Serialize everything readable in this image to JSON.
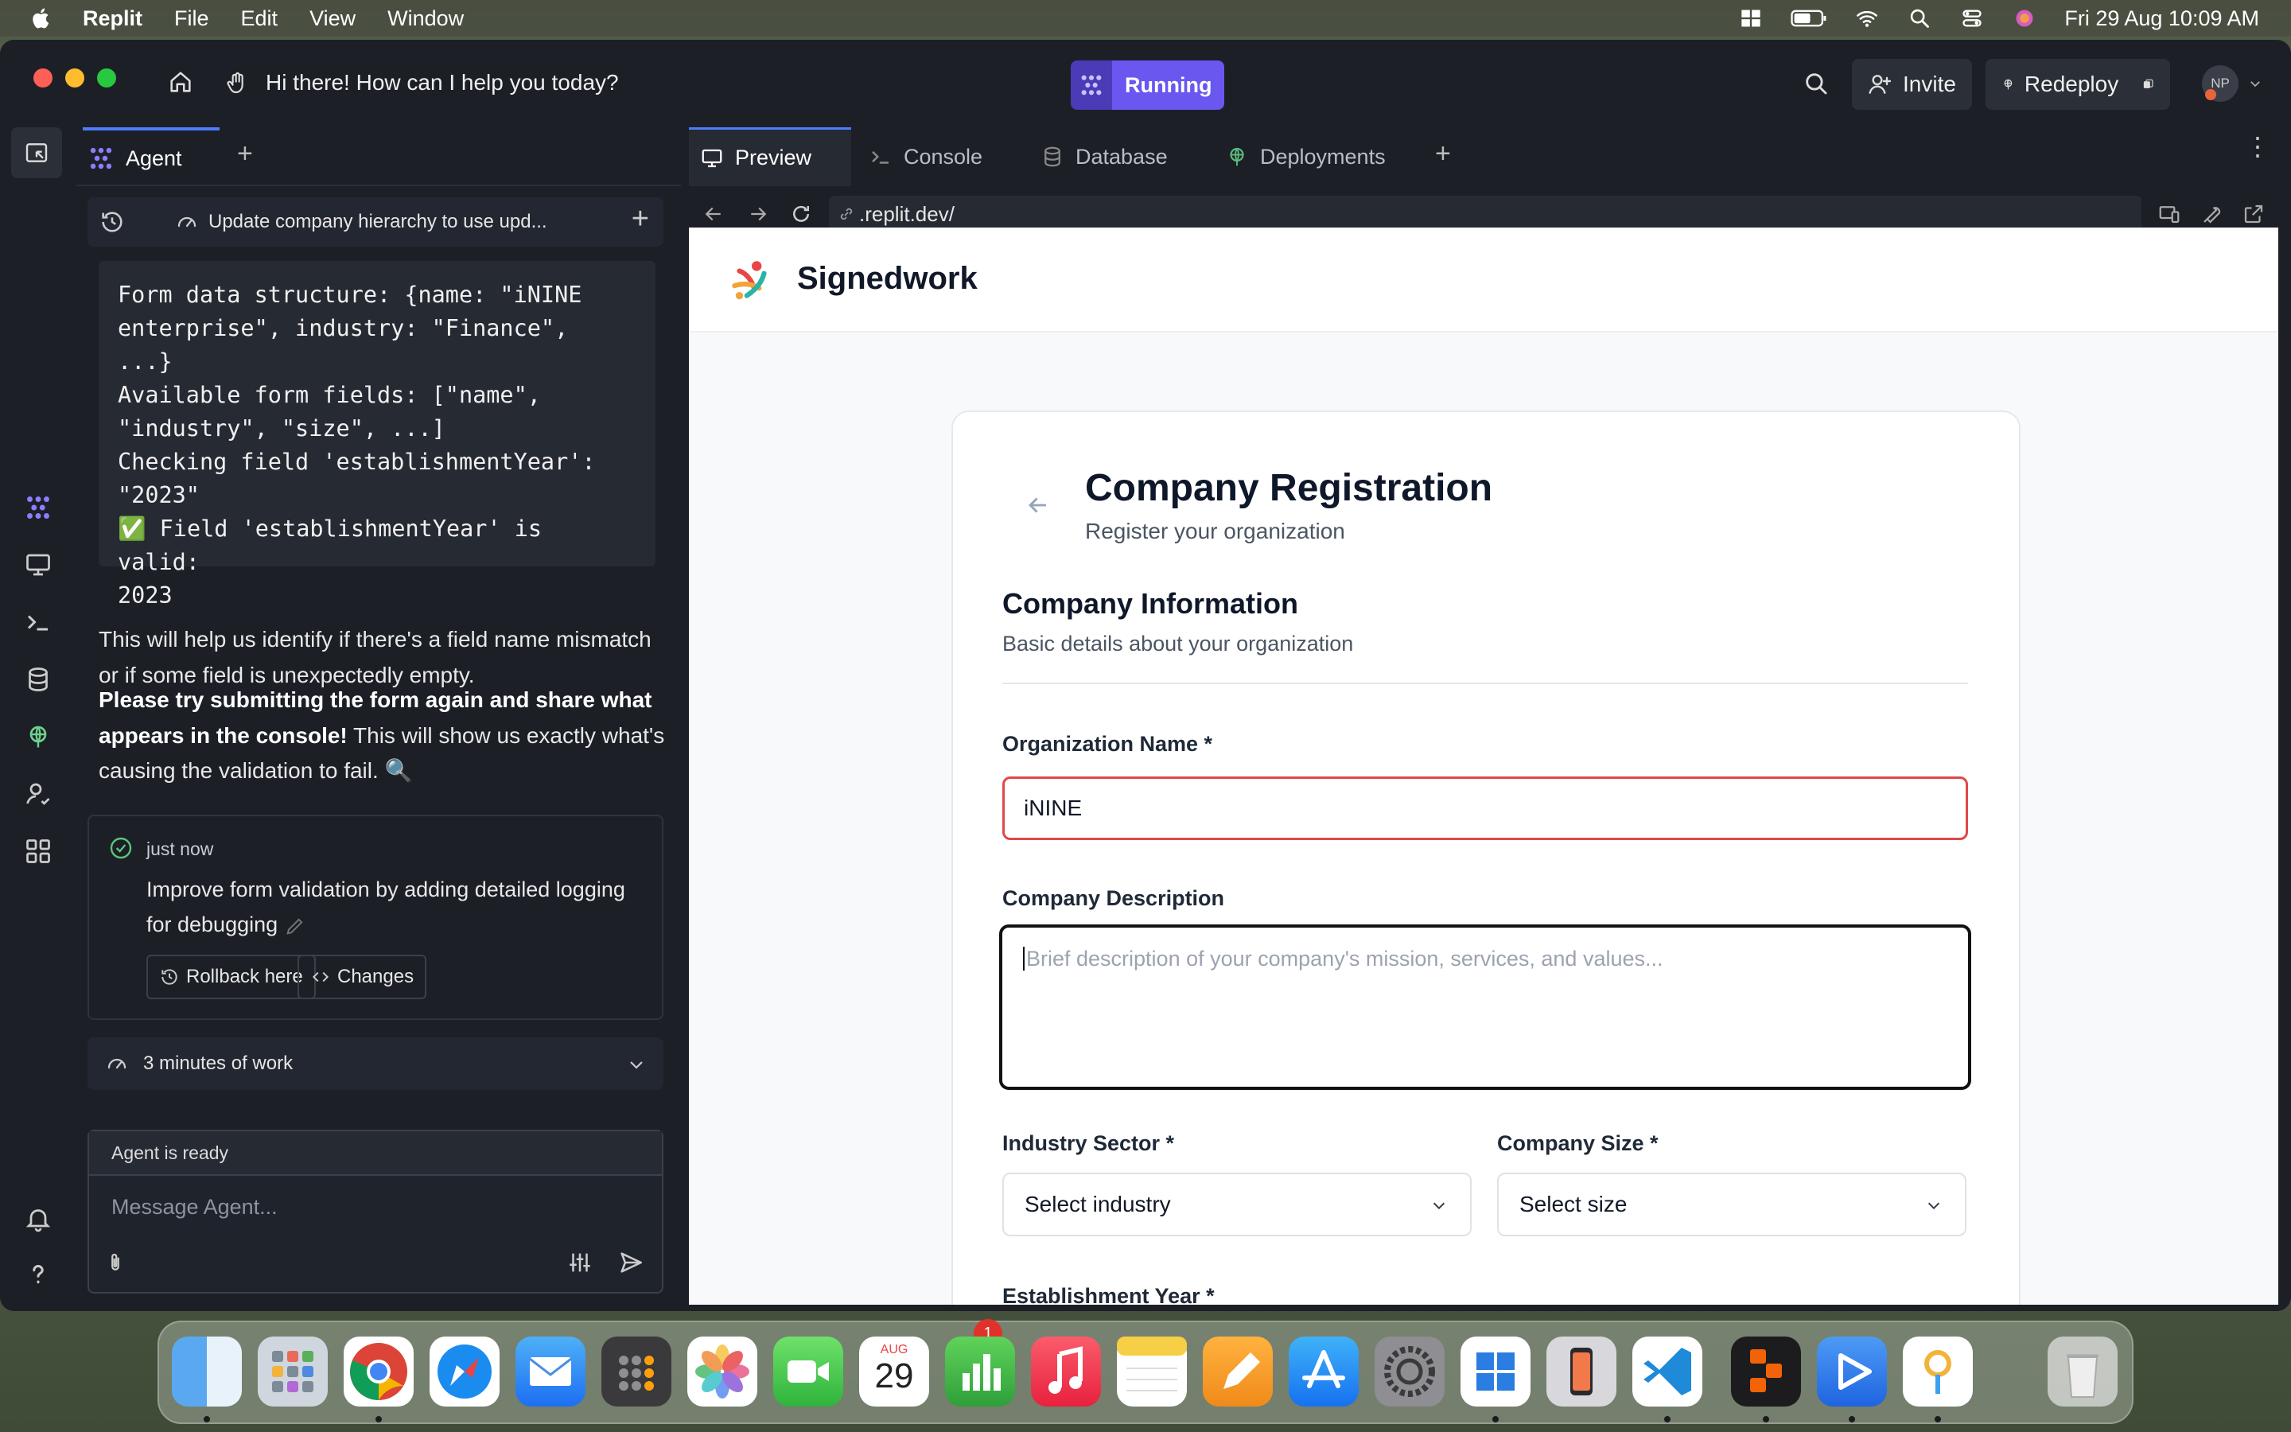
{
  "menubar": {
    "app": "Replit",
    "items": [
      "File",
      "Edit",
      "View",
      "Window"
    ],
    "clock": "Fri 29 Aug  10:09 AM"
  },
  "titlebar": {
    "greeting": "Hi there! How can I help you today?",
    "status": "Running",
    "invite": "Invite",
    "redeploy": "Redeploy",
    "avatar": "NP"
  },
  "agent": {
    "tab": "Agent",
    "thread_title": "Update company hierarchy to use upd...",
    "code_text": "Form data structure: {name: \"iNINE\nenterprise\", industry: \"Finance\", ...}\nAvailable form fields: [\"name\",\n\"industry\", \"size\", ...]\nChecking field 'establishmentYear':\n\"2023\"\n✅ Field 'establishmentYear' is valid:\n2023",
    "para1": "This will help us identify if there's a field name mismatch or if some field is unexpectedly empty.",
    "para2_bold": "Please try submitting the form again and share what appears in the console!",
    "para2_rest": " This will show us exactly what's causing the validation to fail. 🔍",
    "checkpoint_time": "just now",
    "checkpoint_desc": "Improve form validation by adding detailed logging for debugging",
    "rollback": "Rollback here",
    "changes": "Changes",
    "work": "3 minutes of work",
    "status": "Agent is ready",
    "placeholder": "Message Agent..."
  },
  "pane": {
    "tabs": [
      "Preview",
      "Console",
      "Database",
      "Deployments"
    ],
    "url": ".replit.dev/"
  },
  "site": {
    "brand": "Signedwork",
    "title": "Company Registration",
    "subtitle": "Register your organization",
    "section": "Company Information",
    "section_sub": "Basic details about your organization",
    "org_label": "Organization Name *",
    "org_value": "iNINE",
    "desc_label": "Company Description",
    "desc_placeholder": "Brief description of your company's mission, services, and values...",
    "industry_label": "Industry Sector *",
    "industry_value": "Select industry",
    "size_label": "Company Size *",
    "size_value": "Select size",
    "year_label": "Establishment Year *"
  },
  "dock": {
    "calendar_month": "AUG",
    "calendar_day": "29",
    "facetime_badge": "1"
  },
  "colors": {
    "accent": "#6a57f0",
    "tab_accent": "#4f7cff",
    "error": "#e04848"
  }
}
